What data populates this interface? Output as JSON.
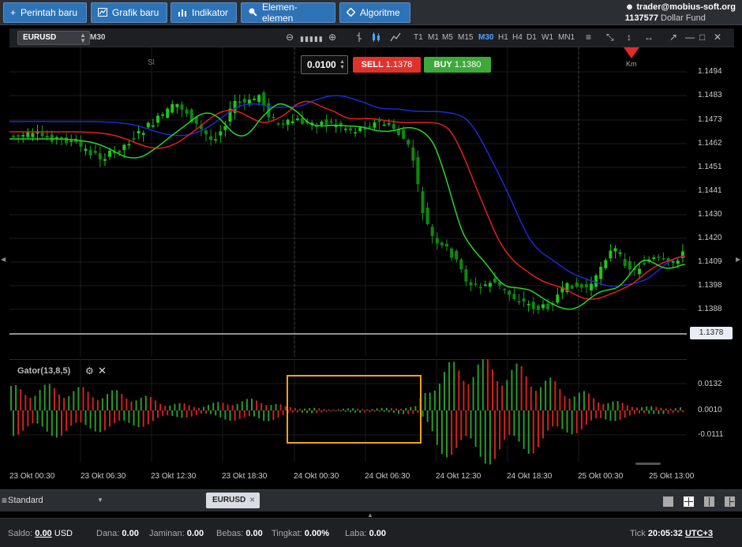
{
  "toolbar": {
    "buttons": [
      {
        "label": "Perintah baru",
        "icon": "plus-icon"
      },
      {
        "label": "Grafik baru",
        "icon": "chart-icon"
      },
      {
        "label": "Indikator",
        "icon": "bars-icon"
      },
      {
        "label": "Elemen-elemen",
        "icon": "tools-icon"
      },
      {
        "label": "Algoritme",
        "icon": "diamond-icon"
      }
    ],
    "account": {
      "user": "trader@mobius-soft.org",
      "number": "1137577",
      "fund": "Dollar Fund"
    }
  },
  "chart_toolbar": {
    "symbol": "EURUSD",
    "timeframe": "M30",
    "timeframes": [
      "T1",
      "M1",
      "M5",
      "M15",
      "M30",
      "H1",
      "H4",
      "D1",
      "W1",
      "MN1"
    ],
    "active_timeframe": "M30"
  },
  "trade": {
    "lot": "0.0100",
    "sell_label": "SELL",
    "sell_price": "1.1378",
    "buy_label": "BUY",
    "buy_price": "1.1380"
  },
  "markers": {
    "sl": "Sl",
    "km": "Km"
  },
  "price_axis": {
    "ticks": [
      "1.1494",
      "1.1483",
      "1.1473",
      "1.1462",
      "1.1451",
      "1.1441",
      "1.1430",
      "1.1420",
      "1.1409",
      "1.1398",
      "1.1388"
    ],
    "current": "1.1378"
  },
  "indicator": {
    "name": "Gator(13,8,5)",
    "ticks": [
      "0.0132",
      "0.0010",
      "-0.0111"
    ]
  },
  "time_axis": [
    "23 Okt 00:30",
    "23 Okt 06:30",
    "23 Okt 12:30",
    "23 Okt 18:30",
    "24 Okt 00:30",
    "24 Okt 06:30",
    "24 Okt 12:30",
    "24 Okt 18:30",
    "25 Okt 00:30",
    "25 Okt 13:00"
  ],
  "workspace": {
    "name": "Standard",
    "tab": "EURUSD"
  },
  "status": {
    "saldo_label": "Saldo:",
    "saldo": "0.00",
    "currency": "USD",
    "dana_label": "Dana:",
    "dana": "0.00",
    "jaminan_label": "Jaminan:",
    "jaminan": "0.00",
    "bebas_label": "Bebas:",
    "bebas": "0.00",
    "tingkat_label": "Tingkat:",
    "tingkat": "0.00%",
    "laba_label": "Laba:",
    "laba": "0.00",
    "tick_label": "Tick",
    "time": "20:05:32",
    "tz": "UTC+3"
  },
  "colors": {
    "bull": "#22c41e",
    "bear": "#0a7a0a",
    "jaw": "#1a2bd6",
    "teeth": "#e02020",
    "lips": "#28d628",
    "gator_up": "#2a9a2a",
    "gator_down": "#d22020"
  }
}
